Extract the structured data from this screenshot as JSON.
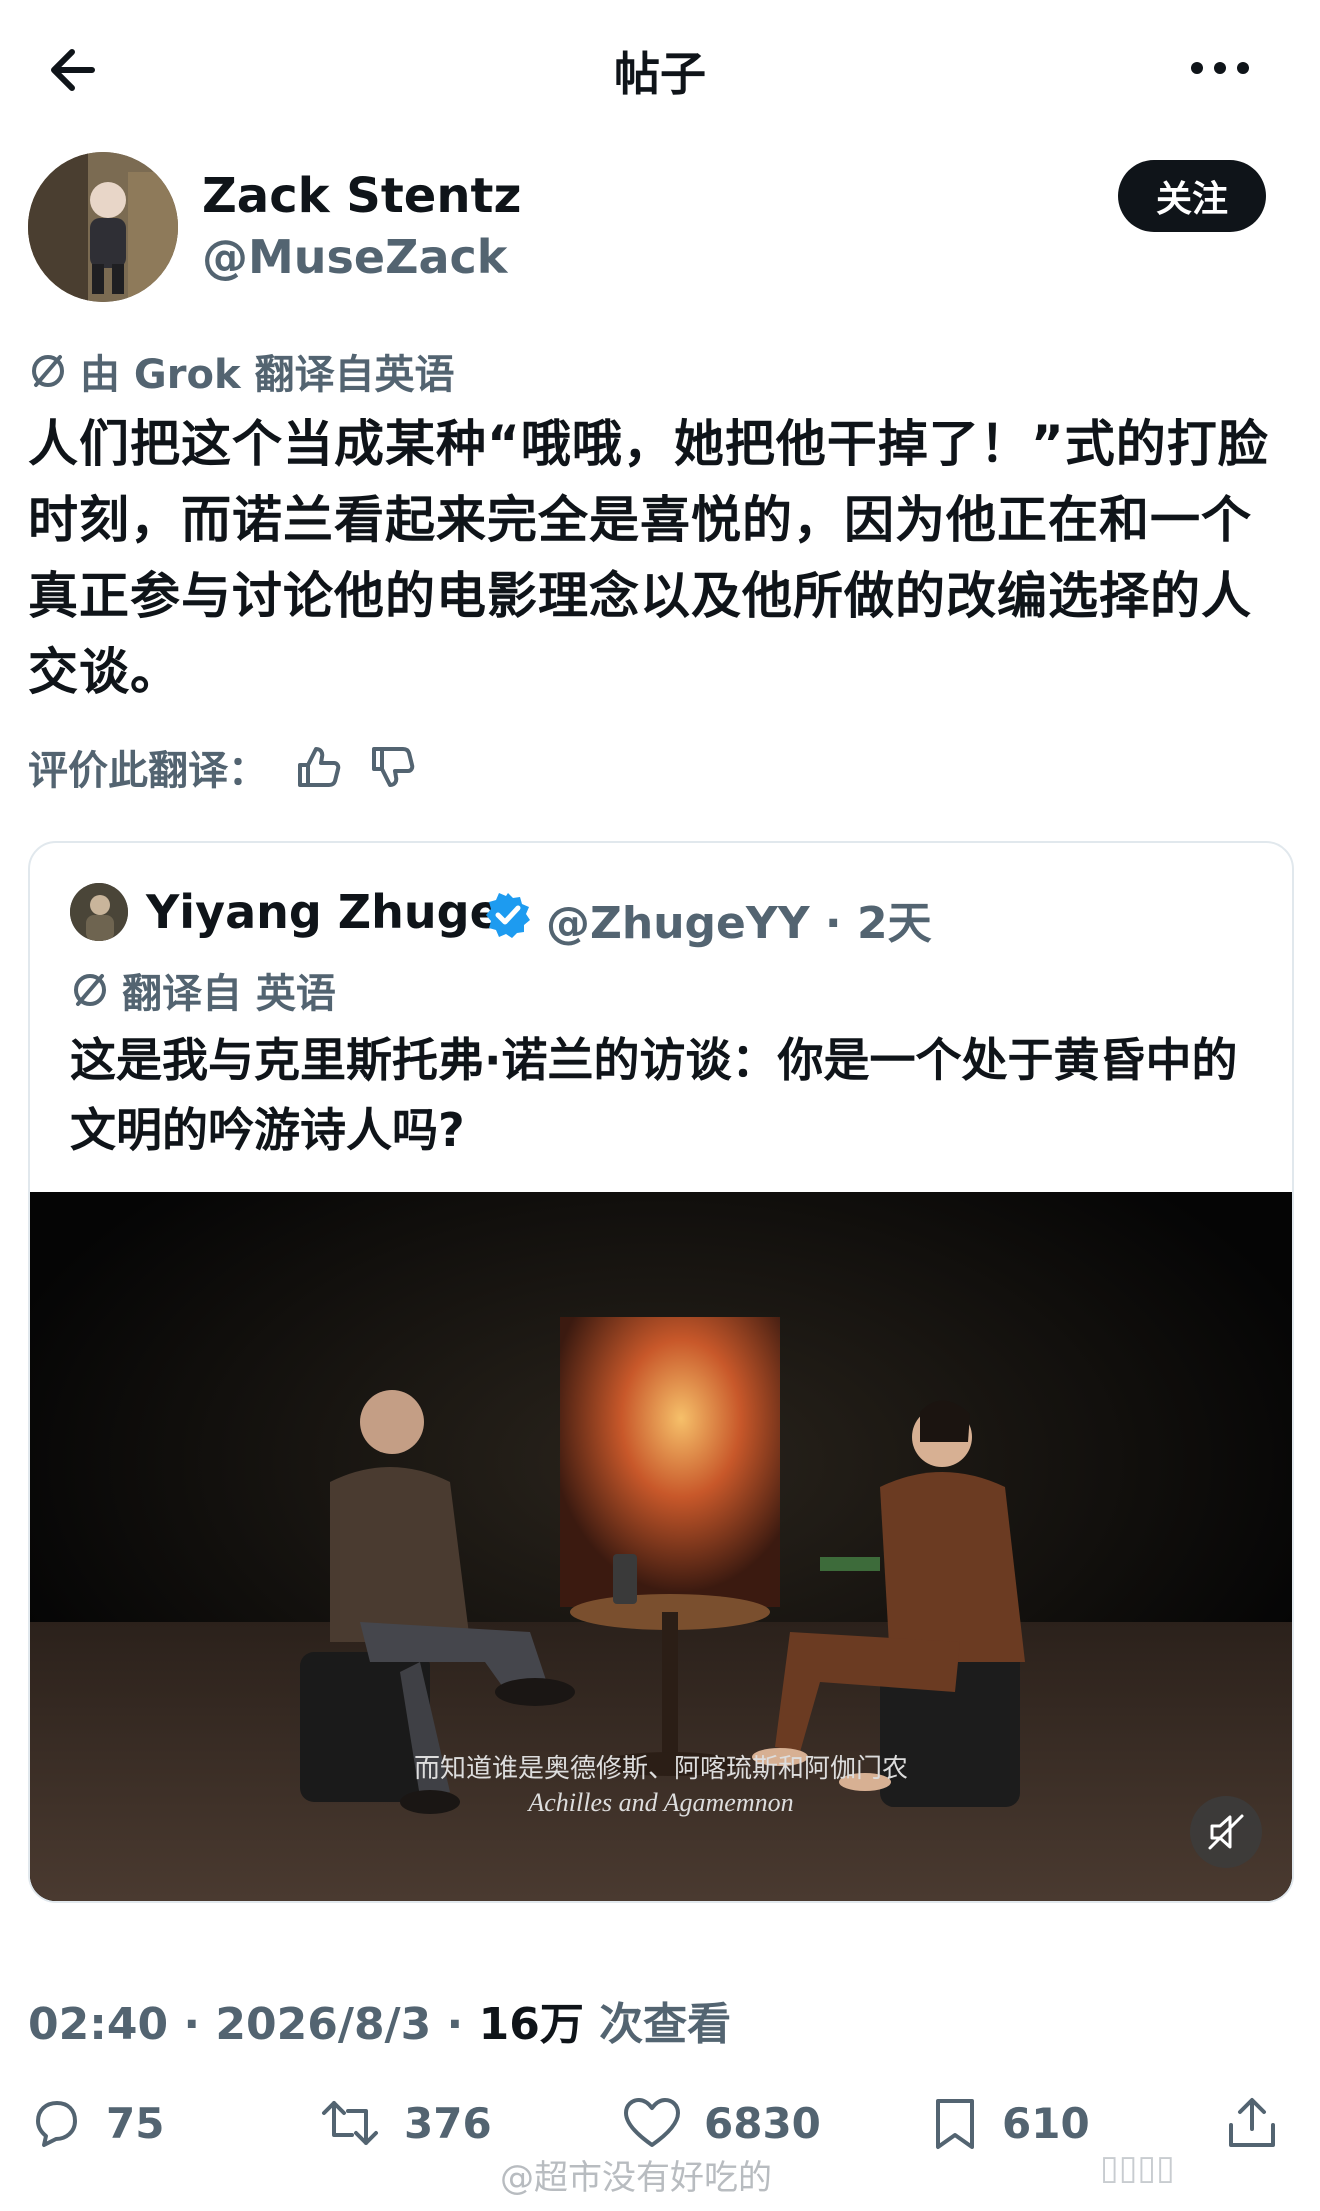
{
  "header": {
    "title": "帖子"
  },
  "author": {
    "name": "Zack Stentz",
    "handle": "@MuseZack",
    "follow_label": "关注"
  },
  "translation": {
    "label": "由 Grok 翻译自英语",
    "rate_label": "评价此翻译："
  },
  "post": {
    "text": "人们把这个当成某种“哦哦，她把他干掉了！”式的打脸时刻，而诺兰看起来完全是喜悦的，因为他正在和一个真正参与讨论他的电影理念以及他所做的改编选择的人交谈。"
  },
  "quote": {
    "name": "Yiyang Zhuge",
    "handle_time": "@ZhugeYY · 2天",
    "translated_label": "翻译自 英语",
    "text": "这是我与克里斯托弗·诺兰的访谈：你是一个处于黄昏中的文明的吟游诗人吗?",
    "video": {
      "subtitle_cn": "而知道谁是奥德修斯、阿喀琉斯和阿伽门农",
      "subtitle_en": "Achilles and Agamemnon"
    }
  },
  "meta": {
    "time_date": "02:40 · 2026/8/3 · ",
    "views_count": "16万",
    "views_label": " 次查看"
  },
  "actions": {
    "replies": "75",
    "reposts": "376",
    "likes": "6830",
    "bookmarks": "610"
  },
  "watermark": {
    "text": "@超市没有好吃的",
    "right": "▯▯▯▯"
  },
  "colors": {
    "text": "#0f1419",
    "secondary": "#536471",
    "verified": "#1d9bf0"
  }
}
